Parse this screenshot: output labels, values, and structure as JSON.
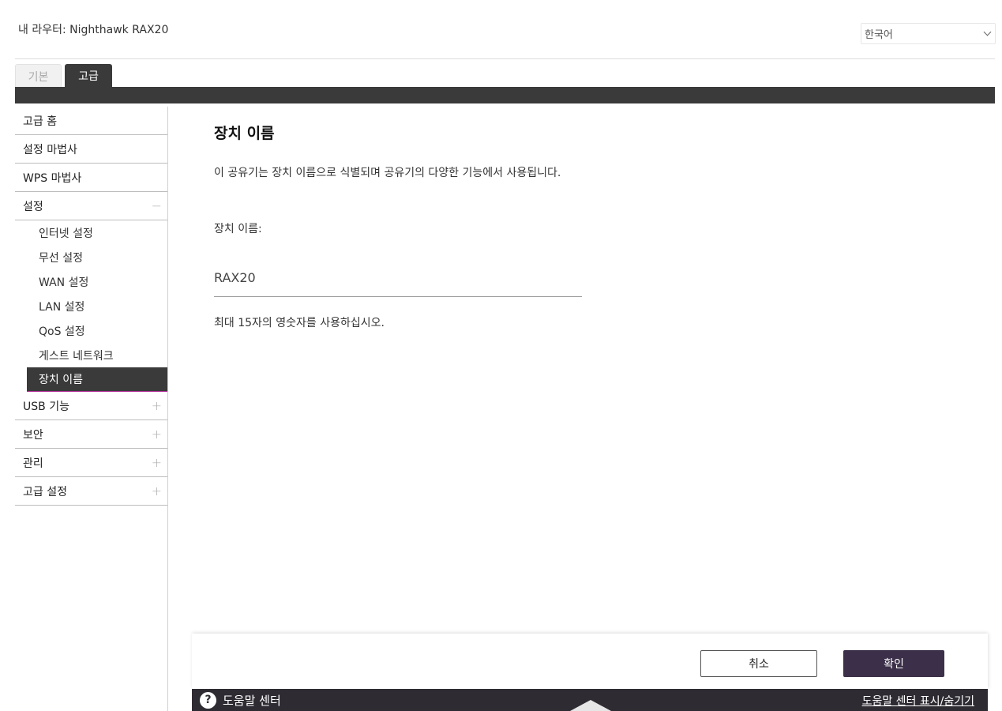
{
  "header": {
    "router_title": "내 라우터: Nighthawk RAX20",
    "language": "한국어"
  },
  "tabs": [
    {
      "label": "기본",
      "active": false
    },
    {
      "label": "고급",
      "active": true
    }
  ],
  "sidebar": {
    "items": [
      {
        "label": "고급 홈",
        "sign": ""
      },
      {
        "label": "설정 마법사",
        "sign": ""
      },
      {
        "label": "WPS 마법사",
        "sign": ""
      },
      {
        "label": "설정",
        "sign": "−"
      },
      {
        "label": "USB 기능",
        "sign": "+"
      },
      {
        "label": "보안",
        "sign": "+"
      },
      {
        "label": "관리",
        "sign": "+"
      },
      {
        "label": "고급 설정",
        "sign": "+"
      }
    ],
    "setup_subitems": [
      {
        "label": "인터넷 설정"
      },
      {
        "label": "무선 설정"
      },
      {
        "label": "WAN 설정"
      },
      {
        "label": "LAN 설정"
      },
      {
        "label": "QoS 설정"
      },
      {
        "label": "게스트 네트워크"
      },
      {
        "label": "장치 이름",
        "active": true
      }
    ]
  },
  "main": {
    "title": "장치 이름",
    "description": "이 공유기는 장치 이름으로 식별되며 공유기의 다양한 기능에서 사용됩니다.",
    "field_label": "장치 이름:",
    "field_value": "RAX20",
    "hint": "최대 15자의 영숫자를 사용하십시오."
  },
  "actions": {
    "cancel_label": "취소",
    "ok_label": "확인"
  },
  "help": {
    "icon": "?",
    "label": "도움말 센터",
    "toggle_label": "도움말 센터 표시/숨기기"
  },
  "colors": {
    "tab_bar": "#3a3a3a",
    "active_item_underline": "#b3309b",
    "primary_button": "#3b2f49",
    "help_bar": "#2f2b33"
  }
}
